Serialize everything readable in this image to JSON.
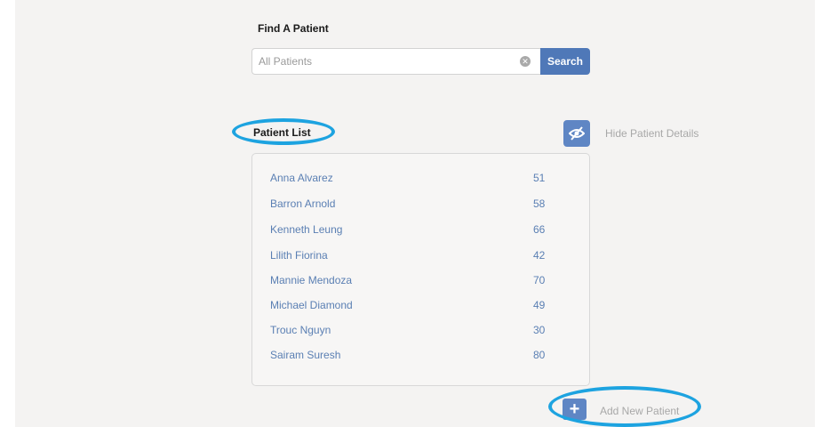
{
  "find": {
    "title": "Find A Patient",
    "placeholder": "All Patients",
    "value": "",
    "search_label": "Search"
  },
  "list": {
    "title": "Patient List",
    "hide_label": "Hide Patient Details",
    "patients": [
      {
        "name": "Anna Alvarez",
        "age": "51"
      },
      {
        "name": "Barron Arnold",
        "age": "58"
      },
      {
        "name": "Kenneth Leung",
        "age": "66"
      },
      {
        "name": "Lilith Fiorina",
        "age": "42"
      },
      {
        "name": "Mannie Mendoza",
        "age": "70"
      },
      {
        "name": "Michael Diamond",
        "age": "49"
      },
      {
        "name": "Trouc Nguyn",
        "age": "30"
      },
      {
        "name": "Sairam Suresh",
        "age": "80"
      }
    ]
  },
  "add": {
    "label": "Add New Patient"
  },
  "icons": {
    "clear": "clear-circle-icon",
    "hide": "eye-slash-icon",
    "add": "plus-icon"
  },
  "colors": {
    "accent": "#4f78b8",
    "link": "#5a7fb3",
    "annotation": "#1da3e0"
  }
}
